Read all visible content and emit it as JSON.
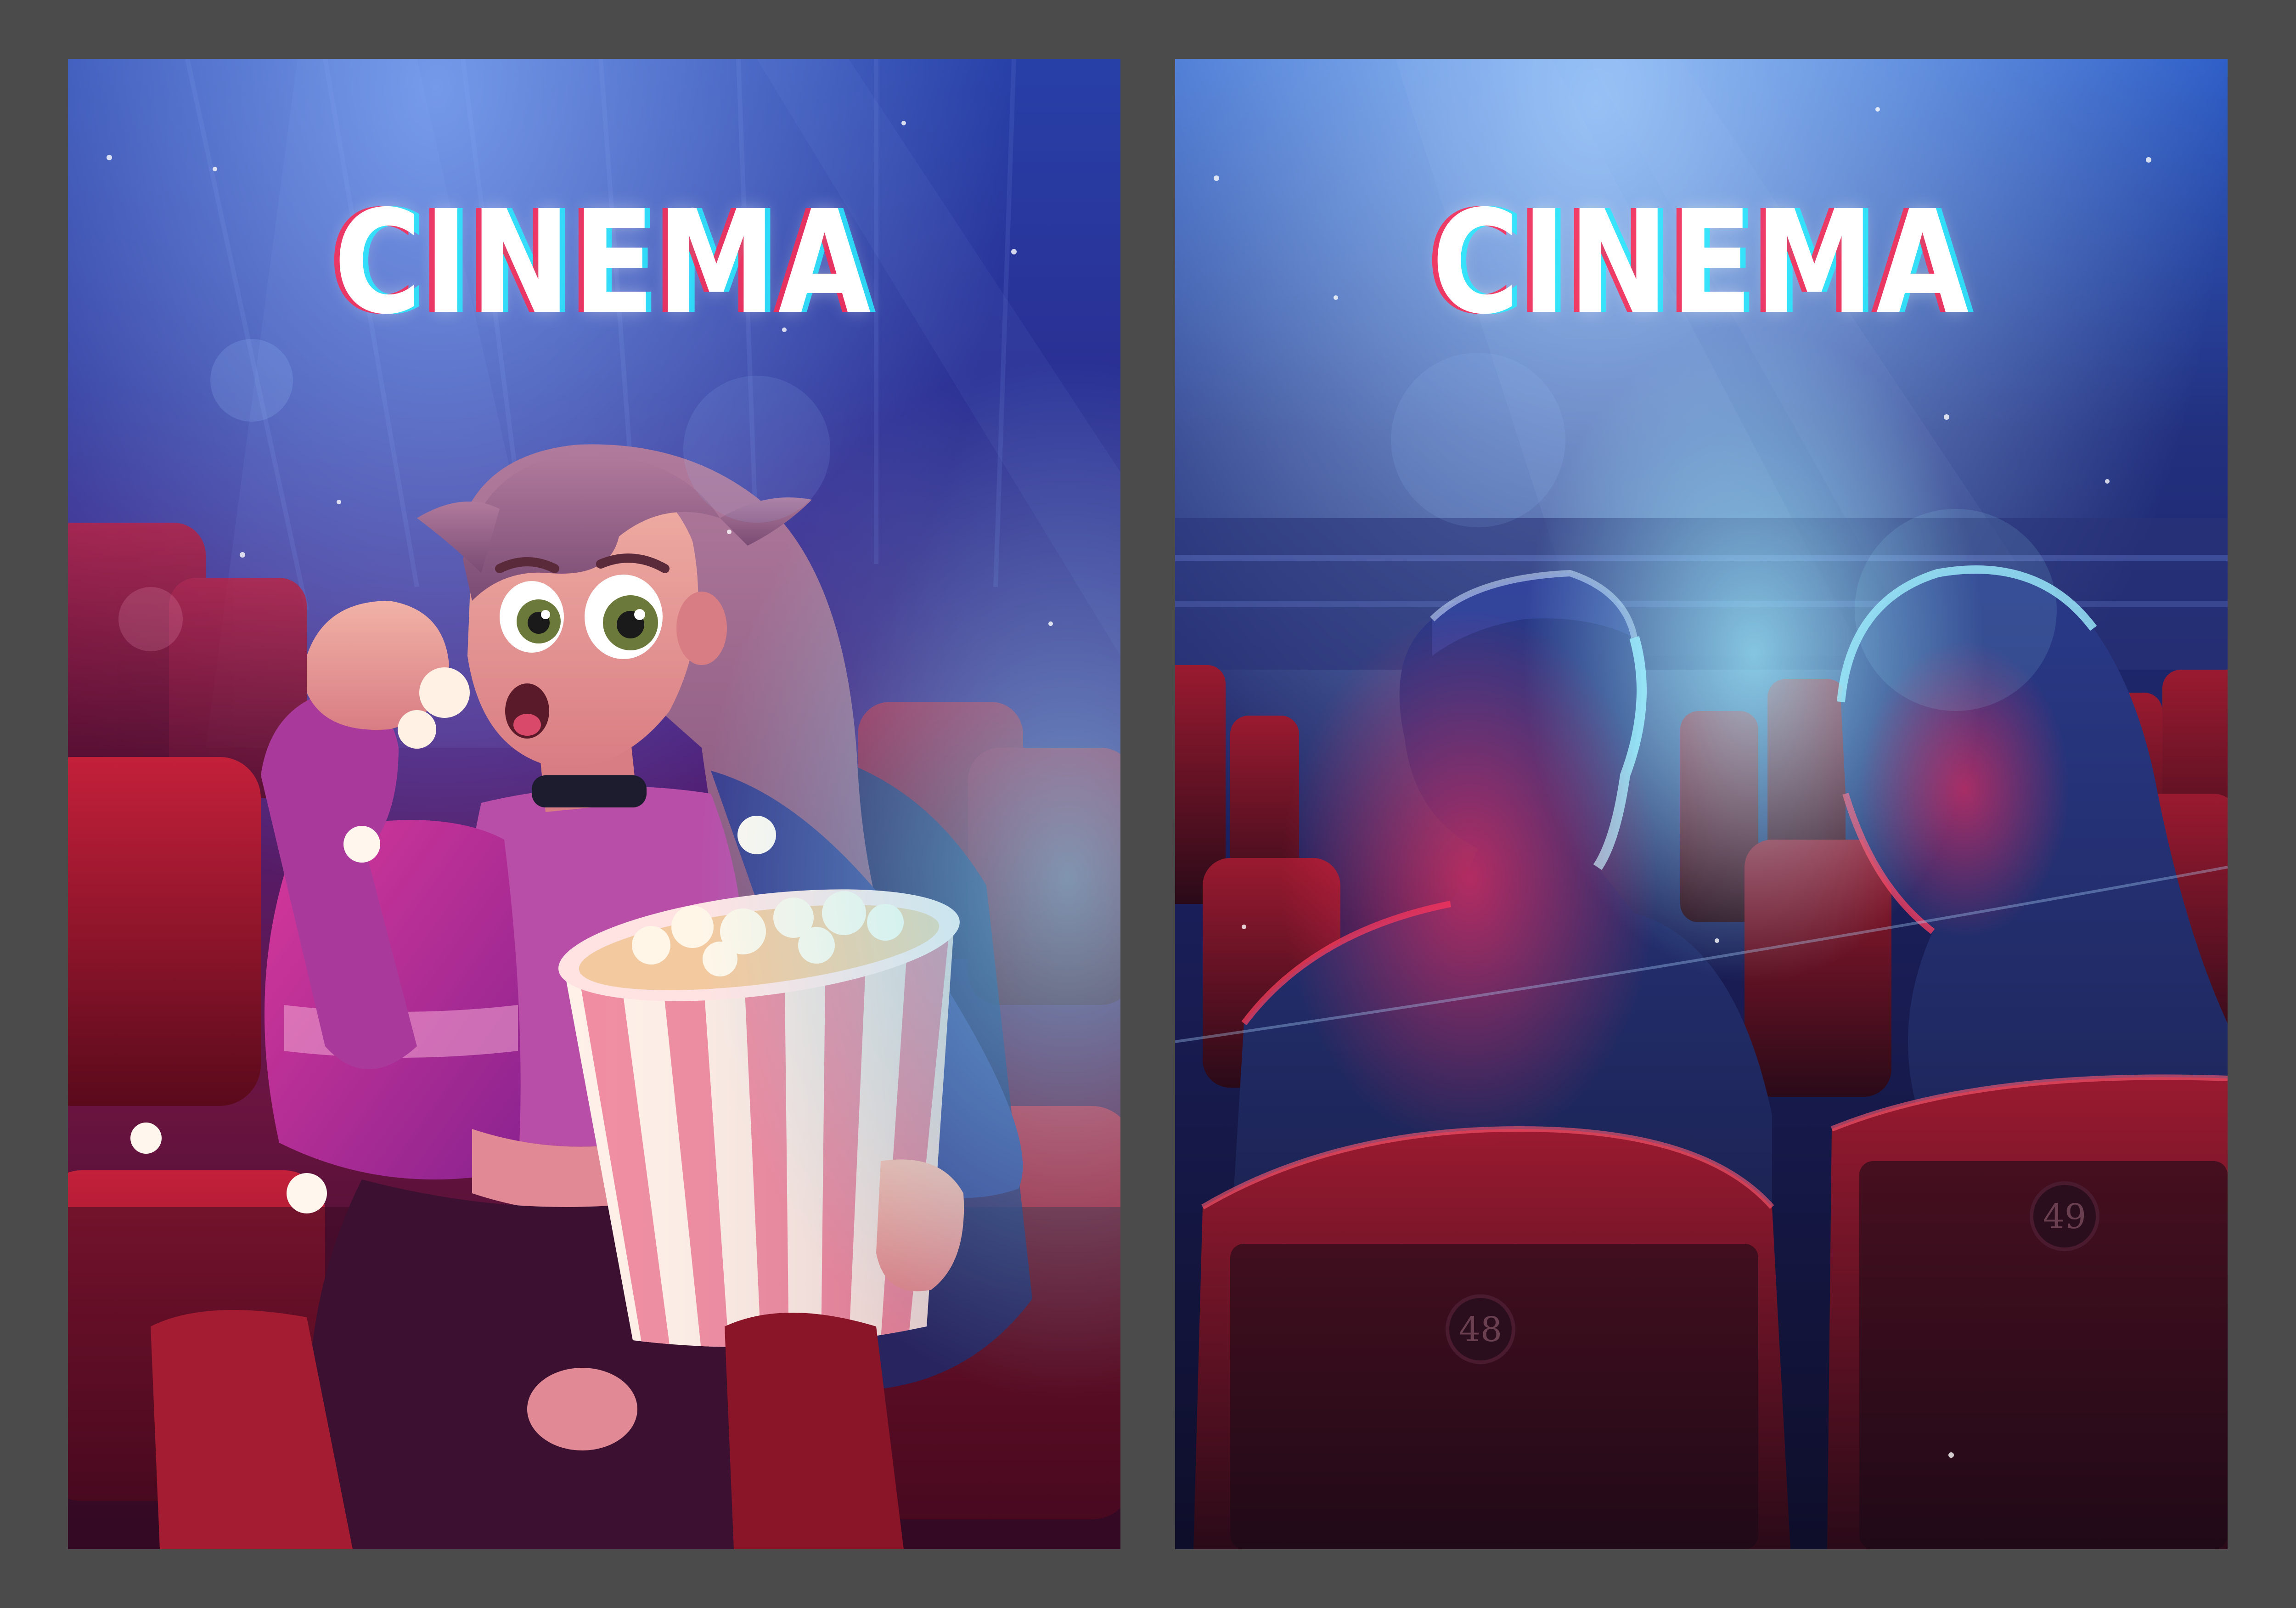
{
  "posters": [
    {
      "title": "CINEMA"
    },
    {
      "title": "CINEMA",
      "seat_numbers": [
        "48",
        "49"
      ]
    }
  ]
}
